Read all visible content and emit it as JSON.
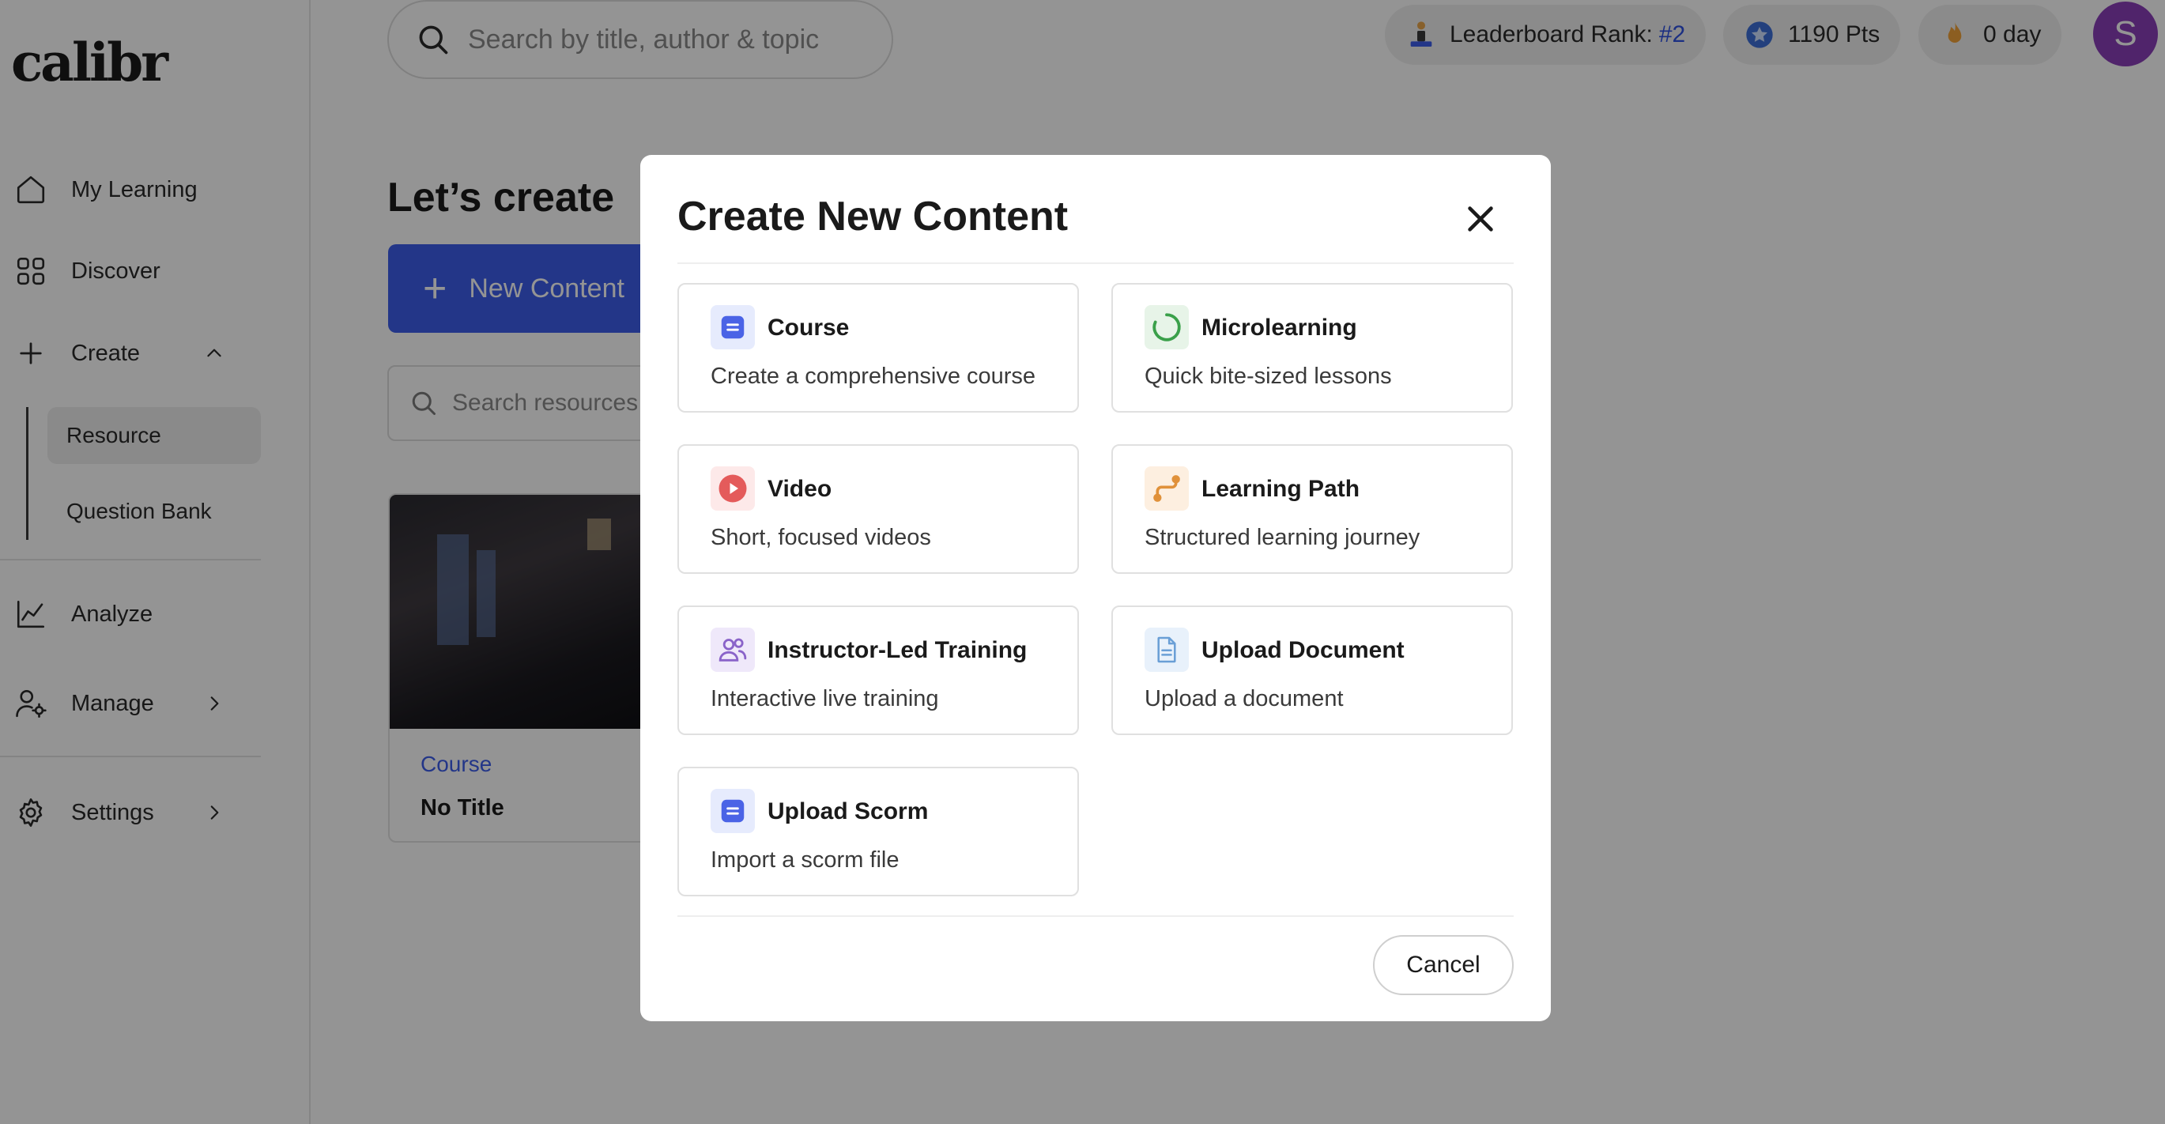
{
  "app": {
    "logo": "calibr"
  },
  "sidebar": {
    "items": [
      {
        "label": "My Learning",
        "icon": "home-icon"
      },
      {
        "label": "Discover",
        "icon": "grid-icon"
      },
      {
        "label": "Create",
        "icon": "plus-icon",
        "expanded": true
      },
      {
        "label": "Analyze",
        "icon": "chart-line-icon"
      },
      {
        "label": "Manage",
        "icon": "user-gear-icon"
      },
      {
        "label": "Settings",
        "icon": "gear-icon"
      }
    ],
    "create_sub": [
      {
        "label": "Resource",
        "active": true
      },
      {
        "label": "Question Bank",
        "active": false
      }
    ]
  },
  "header": {
    "search_placeholder": "Search by title, author & topic",
    "leaderboard_label": "Leaderboard Rank:",
    "leaderboard_rank": "#2",
    "points": "1190 Pts",
    "streak": "0 day",
    "avatar_initial": "S"
  },
  "main": {
    "heading": "Let’s create",
    "new_content_label": "New Content",
    "resource_search_placeholder": "Search resources b",
    "card": {
      "tag": "Course",
      "title": "No Title"
    }
  },
  "modal": {
    "title": "Create New Content",
    "options": [
      {
        "name": "Course",
        "desc": "Create a comprehensive course",
        "icon": "course-icon"
      },
      {
        "name": "Microlearning",
        "desc": "Quick bite-sized lessons",
        "icon": "microlearning-icon"
      },
      {
        "name": "Video",
        "desc": "Short, focused videos",
        "icon": "video-play-icon"
      },
      {
        "name": "Learning Path",
        "desc": "Structured learning journey",
        "icon": "learning-path-icon"
      },
      {
        "name": "Instructor-Led Training",
        "desc": "Interactive live training",
        "icon": "users-icon"
      },
      {
        "name": "Upload Document",
        "desc": "Upload a document",
        "icon": "document-icon"
      },
      {
        "name": "Upload Scorm",
        "desc": "Import a scorm file",
        "icon": "scorm-icon"
      }
    ],
    "cancel_label": "Cancel"
  },
  "colors": {
    "primary": "#3d5eea",
    "avatar": "#8b3fb8",
    "micro_green": "#3aa04a",
    "video_red": "#e45b5b",
    "path_orange": "#e0913a",
    "ilt_purple": "#8a63c9",
    "doc_blue": "#6a9fd6"
  }
}
